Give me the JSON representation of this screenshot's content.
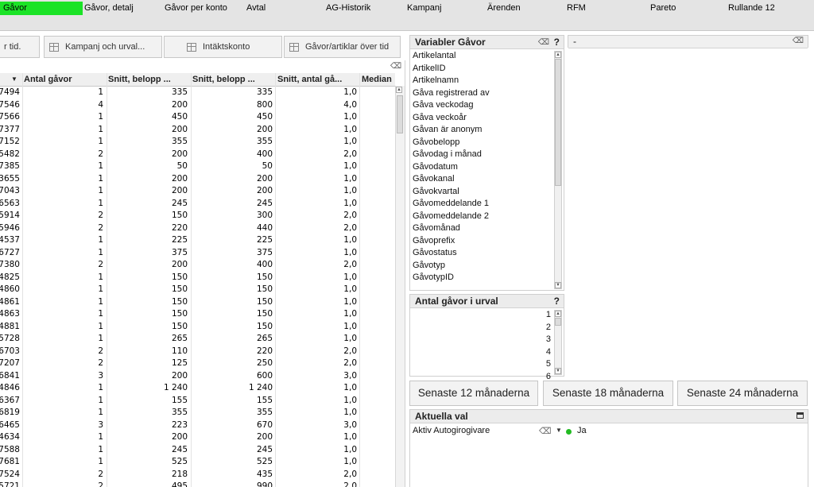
{
  "tabs": [
    {
      "label": "Gåvor",
      "active": true
    },
    {
      "label": "Gåvor, detalj"
    },
    {
      "label": "Gåvor per konto"
    },
    {
      "label": "Avtal"
    },
    {
      "label": "AG-Historik"
    },
    {
      "label": "Kampanj"
    },
    {
      "label": "Ärenden"
    },
    {
      "label": "RFM"
    },
    {
      "label": "Pareto"
    },
    {
      "label": "Rullande 12"
    }
  ],
  "toolbar": {
    "btn_over_tid": "r tid.",
    "btn_kampanj": "Kampanj och urval...",
    "btn_intakt": "Intäktskonto",
    "btn_gavor_artiklar": "Gåvor/artiklar över tid"
  },
  "table": {
    "columns": [
      "Antal gåvor",
      "Snitt, belopp ...",
      "Snitt, belopp ...",
      "Snitt, antal gå...",
      "Median"
    ],
    "rows": [
      [
        "7494",
        "1",
        "335",
        "335",
        "1,0"
      ],
      [
        "7546",
        "4",
        "200",
        "800",
        "4,0"
      ],
      [
        "7566",
        "1",
        "450",
        "450",
        "1,0"
      ],
      [
        "7377",
        "1",
        "200",
        "200",
        "1,0"
      ],
      [
        "7152",
        "1",
        "355",
        "355",
        "1,0"
      ],
      [
        "5482",
        "2",
        "200",
        "400",
        "2,0"
      ],
      [
        "7385",
        "1",
        "50",
        "50",
        "1,0"
      ],
      [
        "3655",
        "1",
        "200",
        "200",
        "1,0"
      ],
      [
        "7043",
        "1",
        "200",
        "200",
        "1,0"
      ],
      [
        "6563",
        "1",
        "245",
        "245",
        "1,0"
      ],
      [
        "5914",
        "2",
        "150",
        "300",
        "2,0"
      ],
      [
        "5946",
        "2",
        "220",
        "440",
        "2,0"
      ],
      [
        "4537",
        "1",
        "225",
        "225",
        "1,0"
      ],
      [
        "6727",
        "1",
        "375",
        "375",
        "1,0"
      ],
      [
        "7380",
        "2",
        "200",
        "400",
        "2,0"
      ],
      [
        "4825",
        "1",
        "150",
        "150",
        "1,0"
      ],
      [
        "4860",
        "1",
        "150",
        "150",
        "1,0"
      ],
      [
        "4861",
        "1",
        "150",
        "150",
        "1,0"
      ],
      [
        "4863",
        "1",
        "150",
        "150",
        "1,0"
      ],
      [
        "4881",
        "1",
        "150",
        "150",
        "1,0"
      ],
      [
        "5728",
        "1",
        "265",
        "265",
        "1,0"
      ],
      [
        "6703",
        "2",
        "110",
        "220",
        "2,0"
      ],
      [
        "7207",
        "2",
        "125",
        "250",
        "2,0"
      ],
      [
        "6841",
        "3",
        "200",
        "600",
        "3,0"
      ],
      [
        "4846",
        "1",
        "1 240",
        "1 240",
        "1,0"
      ],
      [
        "6367",
        "1",
        "155",
        "155",
        "1,0"
      ],
      [
        "6819",
        "1",
        "355",
        "355",
        "1,0"
      ],
      [
        "6465",
        "3",
        "223",
        "670",
        "3,0"
      ],
      [
        "4634",
        "1",
        "200",
        "200",
        "1,0"
      ],
      [
        "7588",
        "1",
        "245",
        "245",
        "1,0"
      ],
      [
        "7681",
        "1",
        "525",
        "525",
        "1,0"
      ],
      [
        "7524",
        "2",
        "218",
        "435",
        "2,0"
      ],
      [
        "5721",
        "2",
        "495",
        "990",
        "2,0"
      ]
    ]
  },
  "variabler": {
    "title": "Variabler Gåvor",
    "help": "?",
    "items": [
      "Artikelantal",
      "ArtikelID",
      "Artikelnamn",
      "Gåva registrerad av",
      "Gåva veckodag",
      "Gåva veckoår",
      "Gåvan är anonym",
      "Gåvobelopp",
      "Gåvodag i månad",
      "Gåvodatum",
      "Gåvokanal",
      "Gåvokvartal",
      "Gåvomeddelande 1",
      "Gåvomeddelande 2",
      "Gåvomånad",
      "Gåvoprefix",
      "Gåvostatus",
      "Gåvotyp",
      "GåvotypID"
    ]
  },
  "chart_panel": {
    "title": "-"
  },
  "antal": {
    "title": "Antal gåvor i urval",
    "help": "?",
    "items": [
      "1",
      "2",
      "3",
      "4",
      "5",
      "6"
    ]
  },
  "period_buttons": [
    "Senaste 12 månaderna",
    "Senaste 18 månaderna",
    "Senaste 24 månaderna"
  ],
  "aktuella": {
    "title": "Aktuella val",
    "field": "Aktiv Autogirogivare",
    "value": "Ja"
  },
  "colors": {
    "active_tab": "#1be327",
    "selection_dot": "#22bb22"
  }
}
